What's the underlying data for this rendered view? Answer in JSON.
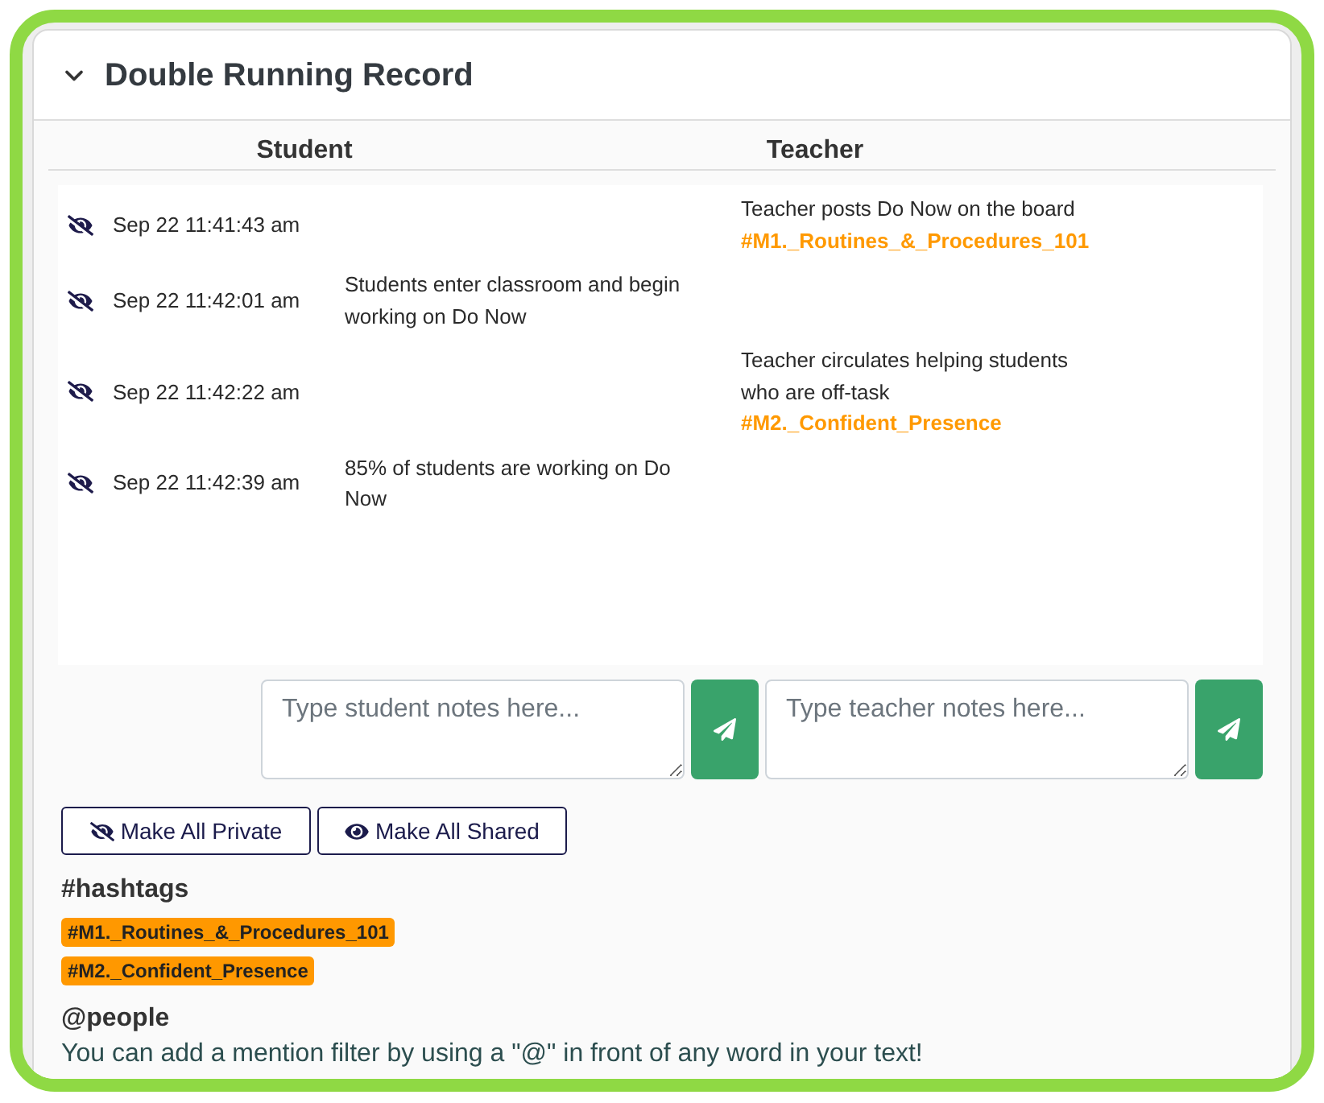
{
  "panel": {
    "title": "Double Running Record",
    "expanded": true
  },
  "columns": [
    "Student",
    "Teacher"
  ],
  "records": [
    {
      "shared": false,
      "time": "Sep 22 11:41:43 am",
      "teacher": "Teacher posts Do Now on the board",
      "teacher_tag": "#M1._Routines_&_Procedures_101"
    },
    {
      "shared": false,
      "time": "Sep 22 11:42:01 am",
      "student": "Students enter classroom and begin working on Do Now"
    },
    {
      "shared": false,
      "time": "Sep 22 11:42:22 am",
      "teacher": "Teacher circulates helping students who are off-task",
      "teacher_tag": "#M2._Confident_Presence"
    },
    {
      "shared": false,
      "time": "Sep 22 11:42:39 am",
      "student": "85% of students are working on Do Now"
    }
  ],
  "inputs": [
    {
      "placeholder": "Type student notes here..."
    },
    {
      "placeholder": "Type teacher notes here..."
    }
  ],
  "actions": [
    {
      "kind": "private",
      "label": "Make All Private"
    },
    {
      "kind": "shared",
      "label": "Make All Shared"
    }
  ],
  "hashtags": {
    "title": "#hashtags",
    "tags": [
      "#M1._Routines_&_Procedures_101",
      "#M2._Confident_Presence"
    ]
  },
  "people": {
    "title": "@people",
    "hint": "You can add a mention filter by using a \"@\" in front of any word in your text!"
  }
}
